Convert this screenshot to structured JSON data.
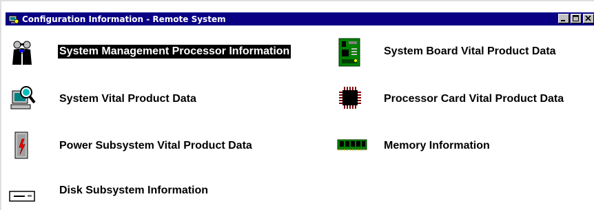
{
  "window": {
    "title": "Configuration Information - Remote System",
    "controls": {
      "minimize": "_",
      "maximize": "□",
      "close": "×"
    }
  },
  "items": [
    {
      "label": "System Management Processor Information",
      "icon": "service-processor-icon",
      "selected": true
    },
    {
      "label": "System Board Vital Product Data",
      "icon": "system-board-icon",
      "selected": false
    },
    {
      "label": "System Vital Product Data",
      "icon": "computer-magnifier-icon",
      "selected": false
    },
    {
      "label": "Processor Card Vital Product Data",
      "icon": "processor-chip-icon",
      "selected": false
    },
    {
      "label": "Power Subsystem Vital Product Data",
      "icon": "power-supply-icon",
      "selected": false
    },
    {
      "label": "Memory Information",
      "icon": "memory-module-icon",
      "selected": false
    },
    {
      "label": "Disk Subsystem Information",
      "icon": "disk-drive-icon",
      "selected": false
    }
  ],
  "colors": {
    "titlebar": "#0a0084",
    "selection": "#000000"
  }
}
